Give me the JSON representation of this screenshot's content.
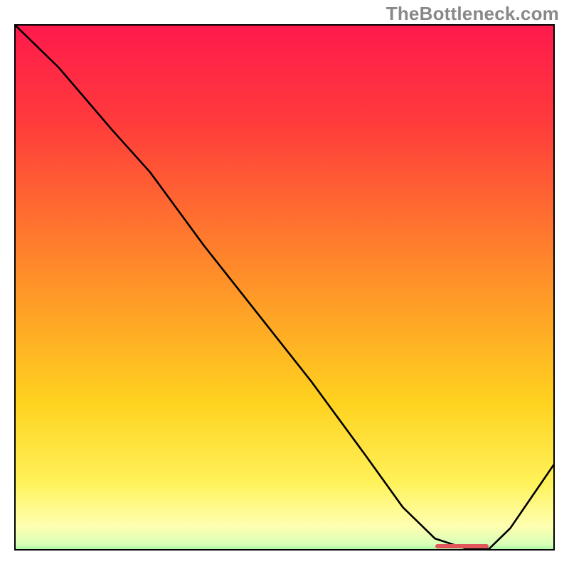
{
  "watermark": "TheBottleneck.com",
  "colors": {
    "gradient_stops": [
      {
        "id": "g0",
        "offset": "0%",
        "color": "#ff1a4d"
      },
      {
        "id": "g1",
        "offset": "18%",
        "color": "#ff3b3b"
      },
      {
        "id": "g2",
        "offset": "45%",
        "color": "#ff8a2a"
      },
      {
        "id": "g3",
        "offset": "70%",
        "color": "#ffd21f"
      },
      {
        "id": "g4",
        "offset": "85%",
        "color": "#fff25a"
      },
      {
        "id": "g5",
        "offset": "93%",
        "color": "#ffffb0"
      },
      {
        "id": "g6",
        "offset": "96.5%",
        "color": "#d8ffb8"
      },
      {
        "id": "g7",
        "offset": "100%",
        "color": "#26e07a"
      }
    ],
    "curve_stroke": "#000000",
    "marker_fill": "#e0565a"
  },
  "chart_data": {
    "type": "line",
    "title": "",
    "xlabel": "",
    "ylabel": "",
    "xlim": [
      0,
      100
    ],
    "ylim": [
      0,
      100
    ],
    "x": [
      0,
      8,
      18,
      25,
      35,
      45,
      55,
      65,
      72,
      78,
      84,
      88,
      92,
      96,
      100
    ],
    "values": [
      100,
      92,
      80,
      72,
      58,
      45,
      32,
      18,
      8,
      2,
      0,
      0,
      4,
      10,
      16
    ],
    "flat_region": {
      "x_start": 78,
      "x_end": 88,
      "y": 0
    },
    "note": "x is horizontal position %, values are vertical % (0 at bottom border, 100 at top border). The curve descends from top-left, reaches zero around x≈78–88, then rises again toward the right. The flat_region marks the plateau highlighted by the small coral bar at the bottom."
  }
}
